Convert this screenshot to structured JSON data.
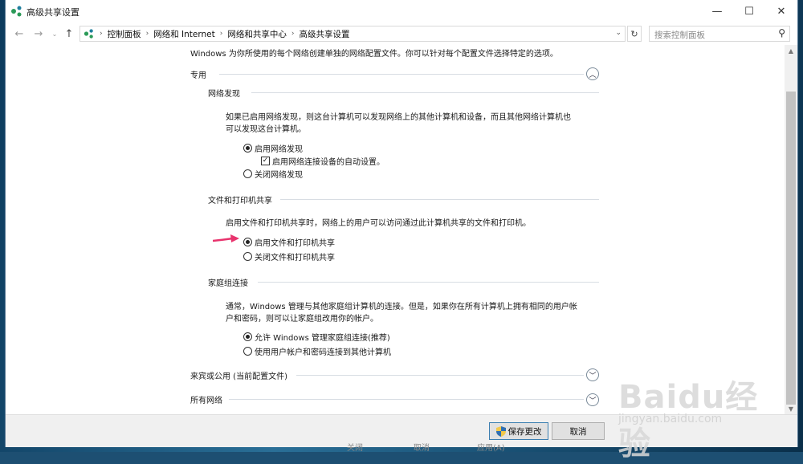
{
  "window": {
    "title": "高级共享设置",
    "controls": {
      "minimize": "—",
      "maximize": "☐",
      "close": "✕"
    }
  },
  "addressbar": {
    "crumbs": [
      "控制面板",
      "网络和 Internet",
      "网络和共享中心",
      "高级共享设置"
    ],
    "search_placeholder": "搜索控制面板"
  },
  "content": {
    "intro": "Windows 为你所使用的每个网络创建单独的网络配置文件。你可以针对每个配置文件选择特定的选项。",
    "profile_private": {
      "label": "专用",
      "network_discovery": {
        "heading": "网络发现",
        "desc_line1": "如果已启用网络发现，则这台计算机可以发现网络上的其他计算机和设备，而且其他网络计算机也",
        "desc_line2": "可以发现这台计算机。",
        "on_label": "启用网络发现",
        "auto_setup_label": "启用网络连接设备的自动设置。",
        "off_label": "关闭网络发现"
      },
      "file_printer": {
        "heading": "文件和打印机共享",
        "desc": "启用文件和打印机共享时，网络上的用户可以访问通过此计算机共享的文件和打印机。",
        "on_label": "启用文件和打印机共享",
        "off_label": "关闭文件和打印机共享"
      },
      "homegroup": {
        "heading": "家庭组连接",
        "desc_line1": "通常，Windows 管理与其他家庭组计算机的连接。但是，如果你在所有计算机上拥有相同的用户帐",
        "desc_line2": "户和密码，则可以让家庭组改用你的帐户。",
        "allow_label": "允许 Windows 管理家庭组连接(推荐)",
        "use_account_label": "使用用户帐户和密码连接到其他计算机"
      }
    },
    "profile_guest": {
      "label": "来宾或公用 (当前配置文件)"
    },
    "profile_all": {
      "label": "所有网络"
    }
  },
  "footer": {
    "save_label": "保存更改",
    "cancel_label": "取消",
    "ghost_buttons": [
      "关闭",
      "取消",
      "应用(A)"
    ]
  },
  "watermark": {
    "brand": "Baidu经验",
    "url": "jingyan.baidu.com"
  },
  "colors": {
    "arrow": "#e8336d",
    "accent": "#3c7fb1"
  }
}
